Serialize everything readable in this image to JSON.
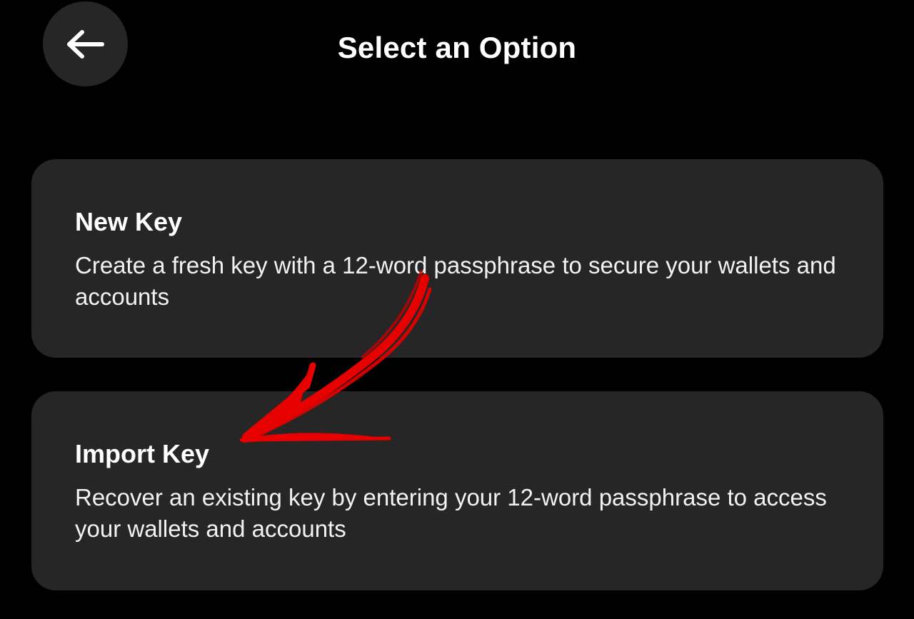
{
  "header": {
    "title": "Select an Option",
    "back_icon": "arrow-left-icon"
  },
  "options": [
    {
      "title": "New Key",
      "description": "Create a fresh key with a 12-word passphrase to secure your wallets and accounts"
    },
    {
      "title": "Import Key",
      "description": "Recover an existing key by entering your 12-word passphrase to access your wallets and accounts"
    }
  ],
  "colors": {
    "background": "#000000",
    "card": "#262626",
    "text": "#ffffff",
    "annotation_arrow": "#e60000"
  },
  "annotation": {
    "icon": "red-hand-drawn-arrow-icon",
    "points_to": "Import Key"
  }
}
